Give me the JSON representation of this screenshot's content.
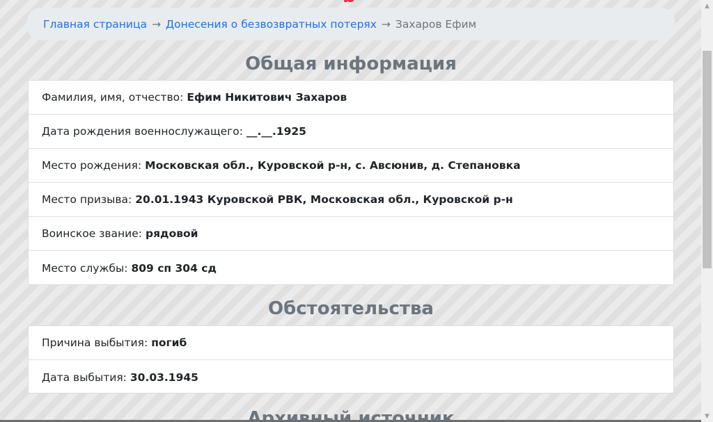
{
  "page": {
    "top_title_fragment": "р"
  },
  "breadcrumb": {
    "home": "Главная страница",
    "separator": "→",
    "reports": "Донесения о безвозвратных потерях",
    "current": "Захаров Ефим"
  },
  "general": {
    "title": "Общая информация",
    "rows": [
      {
        "label": "Фамилия, имя, отчество:",
        "value": "Ефим Никитович Захаров"
      },
      {
        "label": "Дата рождения военнослужащего:",
        "value": "__.__.1925"
      },
      {
        "label": "Место рождения:",
        "value": "Московская обл., Куровской р-н, с. Авсюнив, д. Степановка"
      },
      {
        "label": "Место призыва:",
        "value": "20.01.1943 Куровской РВК, Московская обл., Куровской р-н"
      },
      {
        "label": "Воинское звание:",
        "value": "рядовой"
      },
      {
        "label": "Место службы:",
        "value": "809 сп 304 сд"
      }
    ]
  },
  "circumstances": {
    "title": "Обстоятельства",
    "rows": [
      {
        "label": "Причина выбытия:",
        "value": "погиб"
      },
      {
        "label": "Дата выбытия:",
        "value": "30.03.1945"
      }
    ]
  },
  "archive": {
    "title": "Архивный источник"
  },
  "colors": {
    "link": "#1a73e8",
    "muted": "#6c757d",
    "accent_red": "#dc3545"
  }
}
